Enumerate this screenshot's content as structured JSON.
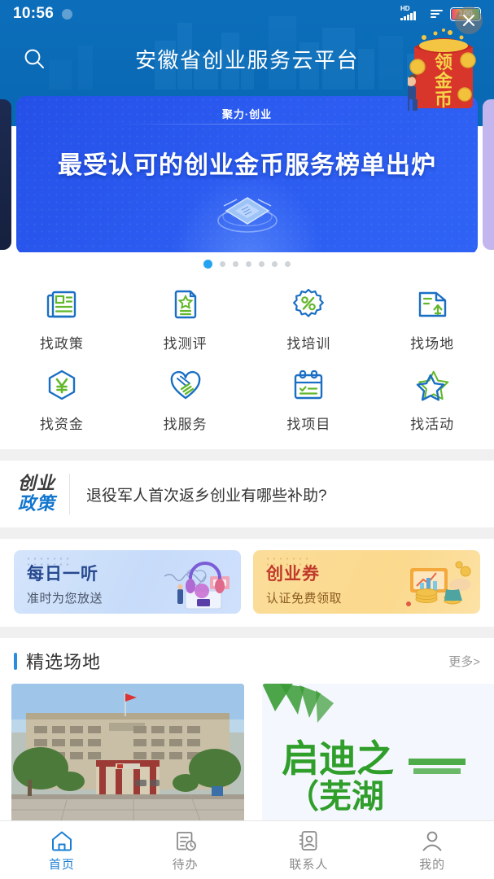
{
  "status_bar": {
    "time": "10:56",
    "network_label": "HD",
    "battery_text": "100",
    "icons": [
      "recording-dot-icon",
      "hd-signal-icon",
      "mobile-data-icon",
      "battery-icon"
    ]
  },
  "header": {
    "title": "安徽省创业服务云平台",
    "search_icon": "search-icon",
    "add_icon": "plus-icon",
    "accent_color": "#0a69b4"
  },
  "carousel": {
    "slide": {
      "eyebrow": "聚力·创业",
      "title": "最受认可的创业金币服务榜单出炉",
      "art": "chip-card-icon"
    },
    "dot_count": 7,
    "active_dot": 1,
    "active_color": "#26a3f0"
  },
  "grid": {
    "items": [
      {
        "label": "找政策",
        "icon": "policy-document-icon"
      },
      {
        "label": "找测评",
        "icon": "assessment-star-icon"
      },
      {
        "label": "找培训",
        "icon": "training-percent-badge-icon"
      },
      {
        "label": "找场地",
        "icon": "venue-map-icon"
      },
      {
        "label": "找资金",
        "icon": "funding-yuan-icon"
      },
      {
        "label": "找服务",
        "icon": "service-handshake-heart-icon"
      },
      {
        "label": "找项目",
        "icon": "project-checklist-icon"
      },
      {
        "label": "找活动",
        "icon": "activity-star-icon"
      }
    ],
    "colors": {
      "blue": "#1a6fc4",
      "green": "#62b72b"
    }
  },
  "policy": {
    "badge_line1": "创业",
    "badge_line2": "政策",
    "headline": "退役军人首次返乡创业有哪些补助?"
  },
  "promos": [
    {
      "title": "每日一听",
      "subtitle": "准时为您放送",
      "art": "headphones-illustration",
      "bg": "#cfe0fc"
    },
    {
      "title": "创业券",
      "subtitle": "认证免费领取",
      "art": "coins-chart-illustration",
      "bg": "#fbd98d"
    }
  ],
  "venue_section": {
    "title": "精选场地",
    "more_label": "更多>",
    "cards": [
      {
        "image": "office-building-photo",
        "name": "venue-card-building"
      },
      {
        "image": "qidi-star-wuhu-banner",
        "title_line1": "启迪之星",
        "title_line2": "（芜湖",
        "name": "venue-card-qidi"
      }
    ]
  },
  "red_packet": {
    "text": "领金币",
    "close_icon": "close-icon"
  },
  "tabbar": {
    "items": [
      {
        "label": "首页",
        "icon": "home-icon",
        "active": true
      },
      {
        "label": "待办",
        "icon": "todo-clock-icon",
        "active": false
      },
      {
        "label": "联系人",
        "icon": "contacts-icon",
        "active": false
      },
      {
        "label": "我的",
        "icon": "profile-person-icon",
        "active": false
      }
    ],
    "active_color": "#1a7fd4",
    "inactive_color": "#8a8a8a"
  }
}
